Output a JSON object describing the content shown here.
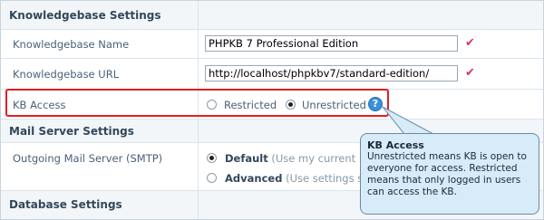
{
  "knowledgebase_settings": {
    "title": "Knowledgebase Settings",
    "name_label": "Knowledgebase Name",
    "name_value": "PHPKB 7 Professional Edition",
    "url_label": "Knowledgebase URL",
    "url_value": "http://localhost/phpkbv7/standard-edition/",
    "check_glyph": "✔",
    "kb_access": {
      "label": "KB Access",
      "options": [
        "Restricted",
        "Unrestricted"
      ],
      "selected": "Unrestricted",
      "help_glyph": "?"
    }
  },
  "mail_server_settings": {
    "title": "Mail Server Settings",
    "smtp_label": "Outgoing Mail Server (SMTP)",
    "options": [
      {
        "name": "Default",
        "desc": "(Use my current"
      },
      {
        "name": "Advanced",
        "desc": "(Use settings s"
      }
    ],
    "selected": "Default"
  },
  "database_settings": {
    "title": "Database Settings"
  },
  "tooltip": {
    "title": "KB Access",
    "body": "Unrestricted means KB is open to everyone for access. Restricted means that only logged in users can access the KB."
  },
  "colors": {
    "highlight": "#e02020",
    "tooltip_bg": "#d7ebf8",
    "help_icon": "#3a8fd9"
  }
}
